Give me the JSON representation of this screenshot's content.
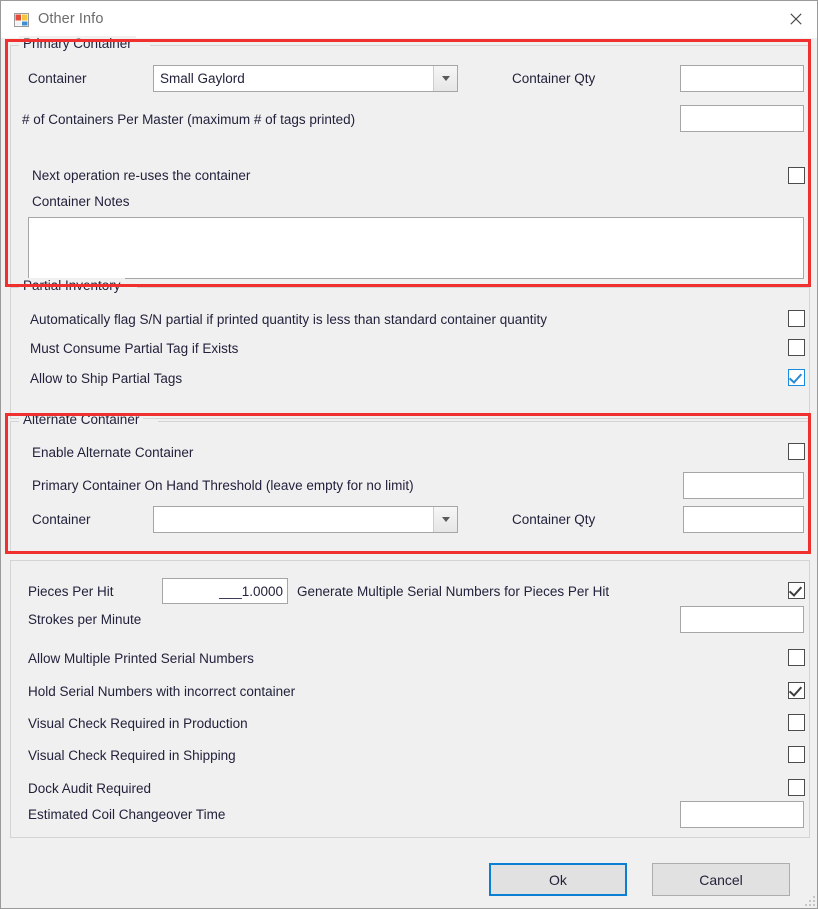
{
  "window": {
    "title": "Other Info",
    "icon": "form-icon",
    "close_label": "Close"
  },
  "primary_container": {
    "legend": "Primary Container",
    "container_label": "Container",
    "container_value": "Small Gaylord",
    "container_qty_label": "Container Qty",
    "container_qty_value": "",
    "containers_per_master_label": "# of Containers Per Master (maximum # of tags printed)",
    "containers_per_master_value": "",
    "reuse_label": "Next operation re-uses the container",
    "reuse_checked": false,
    "notes_label": "Container Notes",
    "notes_value": ""
  },
  "partial_inventory": {
    "legend": "Partial Inventory",
    "rows": [
      {
        "label": "Automatically flag S/N partial if printed quantity is less than standard container quantity",
        "checked": false,
        "style": "dark"
      },
      {
        "label": "Must Consume Partial Tag if Exists",
        "checked": false,
        "style": "dark"
      },
      {
        "label": "Allow to Ship Partial Tags",
        "checked": true,
        "style": "blue"
      }
    ]
  },
  "alternate_container": {
    "legend": "Alternate Container",
    "enable_label": "Enable Alternate Container",
    "enable_checked": false,
    "threshold_label": "Primary Container On Hand Threshold (leave empty for no limit)",
    "threshold_value": "",
    "container_label": "Container",
    "container_value": "",
    "container_qty_label": "Container Qty",
    "container_qty_value": ""
  },
  "misc": {
    "pieces_per_hit_label": "Pieces Per Hit",
    "pieces_per_hit_value": "___1.0000",
    "generate_multiple_label": "Generate Multiple Serial Numbers for Pieces Per Hit",
    "generate_multiple_checked": true,
    "strokes_label": "Strokes per Minute",
    "strokes_value": "",
    "allow_multiple_label": "Allow Multiple Printed Serial Numbers",
    "allow_multiple_checked": false,
    "hold_serial_label": "Hold Serial Numbers with incorrect container",
    "hold_serial_checked": true,
    "visual_production_label": "Visual Check Required in Production",
    "visual_production_checked": false,
    "visual_shipping_label": "Visual Check Required in Shipping",
    "visual_shipping_checked": false,
    "dock_audit_label": "Dock Audit Required",
    "dock_audit_checked": false,
    "coil_changeover_label": "Estimated Coil Changeover Time",
    "coil_changeover_value": ""
  },
  "footer": {
    "ok_label": "Ok",
    "cancel_label": "Cancel"
  },
  "annotations": {
    "accent_color": "#f0302f",
    "regions": [
      {
        "name": "primary-container-highlight"
      },
      {
        "name": "alternate-container-highlight"
      }
    ]
  }
}
